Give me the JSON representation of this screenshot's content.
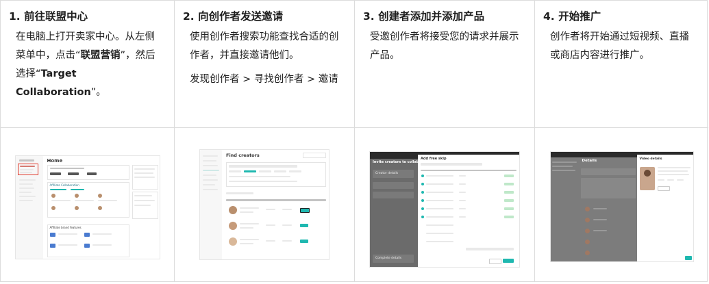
{
  "steps": [
    {
      "title": "1. 前往联盟中心",
      "body_parts": [
        "在电脑上打开卖家中心。从左侧菜单中，点击“",
        "联盟营销",
        "”，然后选择“",
        "Target Collaboration",
        "”。"
      ]
    },
    {
      "title": "2. 向创作者发送邀请",
      "body": "使用创作者搜索功能查找合适的创作者，并直接邀请他们。",
      "path": "发现创作者 > 寻找创作者 > 邀请"
    },
    {
      "title": "3. 创建者添加并添加产品",
      "body": "受邀创作者将接受您的请求并展示产品。"
    },
    {
      "title": "4. 开始推广",
      "body": "创作者将开始通过短视频、直播或商店内容进行推广。"
    }
  ],
  "screenshots": {
    "s1": {
      "heading": "Home",
      "section_a": "Affiliate Collaboration",
      "section_b": "Affiliate brand features"
    },
    "s2": {
      "heading": "Find creators"
    },
    "s3": {
      "left_heading": "Invite creators to collabo",
      "modal_title": "Add free skip",
      "row1": "Creator details",
      "row2": "Complete details"
    },
    "s4": {
      "heading": "Details",
      "panel_title": "Video details"
    }
  },
  "colors": {
    "accent": "#1fb8b0",
    "border": "#dcdcdc",
    "highlight": "#e0392b"
  }
}
